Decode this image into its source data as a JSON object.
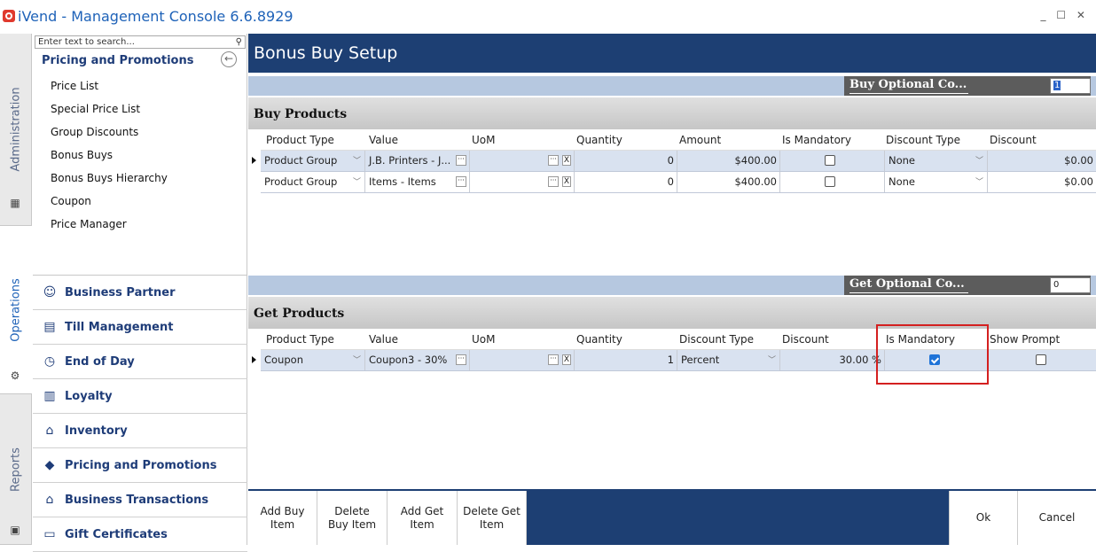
{
  "window": {
    "title": "iVend - Management Console  6.6.8929",
    "controls": "_ ☐ ✕"
  },
  "side_tabs": {
    "administration": "Administration",
    "operations": "Operations",
    "reports": "Reports"
  },
  "nav": {
    "search_placeholder": "Enter text to search...",
    "header": "Pricing and Promotions",
    "items": [
      "Price List",
      "Special Price List",
      "Group Discounts",
      "Bonus Buys",
      "Bonus Buys Hierarchy",
      "Coupon",
      "Price Manager"
    ],
    "modules": [
      "Business Partner",
      "Till Management",
      "End of Day",
      "Loyalty",
      "Inventory",
      "Pricing and Promotions",
      "Business Transactions",
      "Gift Certificates"
    ]
  },
  "page": {
    "title": "Bonus Buy Setup"
  },
  "buy_optional": {
    "label": "Buy Optional Co...",
    "value": "1"
  },
  "get_optional": {
    "label": "Get Optional Co...",
    "value": "0"
  },
  "buy": {
    "header": "Buy Products",
    "columns": [
      "Product Type",
      "Value",
      "UoM",
      "Quantity",
      "Amount",
      "Is Mandatory",
      "Discount Type",
      "Discount"
    ],
    "rows": [
      {
        "product_type": "Product Group",
        "value": "J.B. Printers - J...",
        "uom": "",
        "quantity": "0",
        "amount": "$400.00",
        "is_mandatory": false,
        "discount_type": "None",
        "discount": "$0.00"
      },
      {
        "product_type": "Product Group",
        "value": "Items - Items",
        "uom": "",
        "quantity": "0",
        "amount": "$400.00",
        "is_mandatory": false,
        "discount_type": "None",
        "discount": "$0.00"
      }
    ]
  },
  "get": {
    "header": "Get Products",
    "columns": [
      "Product Type",
      "Value",
      "UoM",
      "Quantity",
      "Discount Type",
      "Discount",
      "Is Mandatory",
      "Show Prompt"
    ],
    "rows": [
      {
        "product_type": "Coupon",
        "value": "Coupon3 - 30%",
        "uom": "",
        "quantity": "1",
        "discount_type": "Percent",
        "discount": "30.00 %",
        "is_mandatory": true,
        "show_prompt": false
      }
    ]
  },
  "footer": {
    "add_buy": "Add Buy Item",
    "delete_buy": "Delete Buy Item",
    "add_get": "Add Get Item",
    "delete_get": "Delete Get Item",
    "ok": "Ok",
    "cancel": "Cancel"
  },
  "colors": {
    "header_blue": "#1d3f73",
    "band_blue": "#b6c8e0",
    "highlight_red": "#d42020"
  }
}
